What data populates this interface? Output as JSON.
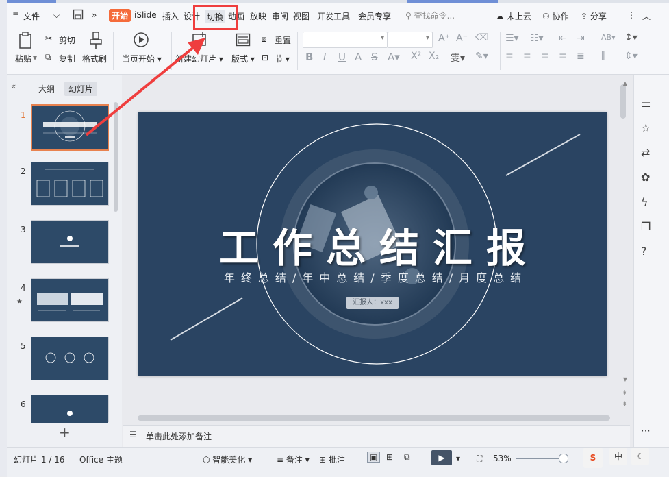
{
  "menu": {
    "file": "文件",
    "tabs": [
      "开始",
      "iSlide",
      "插入",
      "设计",
      "切换",
      "动画",
      "放映",
      "审阅",
      "视图",
      "开发工具",
      "会员专享"
    ],
    "search_placeholder": "查找命令...",
    "cloud": "未上云",
    "collab": "协作",
    "share": "分享"
  },
  "ribbon": {
    "paste": "粘贴",
    "cut": "剪切",
    "copy": "复制",
    "format_painter": "格式刷",
    "from_current": "当页开始",
    "new_slide": "新建幻灯片",
    "layout": "版式",
    "reset": "重置",
    "section": "节"
  },
  "thumbs": {
    "tab_outline": "大纲",
    "tab_slides": "幻灯片",
    "numbers": [
      "1",
      "2",
      "3",
      "4",
      "5",
      "6"
    ],
    "add": "+"
  },
  "slide": {
    "title": "工作总结汇报",
    "subtitle": "年终总结/年中总结/季度总结/月度总结",
    "reporter": "汇报人：xxx"
  },
  "notes": {
    "placeholder": "单击此处添加备注"
  },
  "status": {
    "slide_counter": "幻灯片 1 / 16",
    "theme": "Office 主题",
    "beautify": "智能美化",
    "notes": "备注",
    "comments": "批注",
    "zoom": "53%"
  },
  "colors": {
    "accent_orange": "#f56b3b",
    "slide_bg": "#2a4462",
    "highlight_red": "#ef3e3e"
  }
}
